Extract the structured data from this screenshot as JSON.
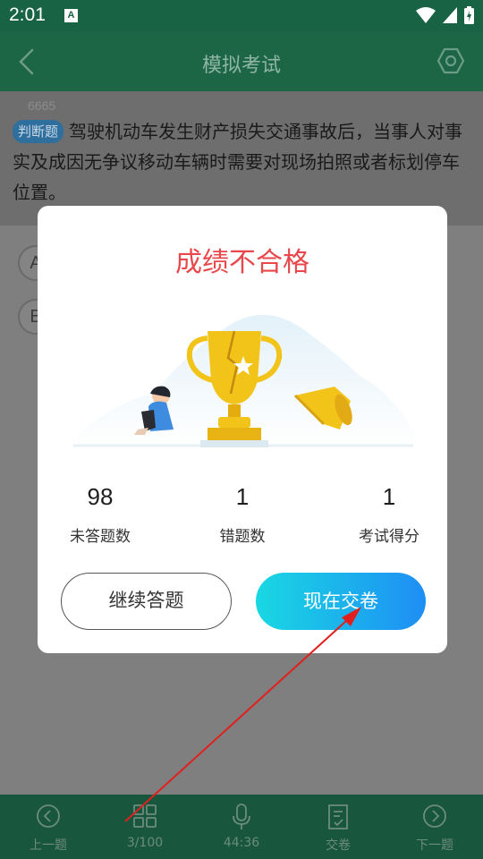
{
  "status": {
    "time": "2:01",
    "app_icon_letter": "A"
  },
  "header": {
    "title": "模拟考试"
  },
  "question": {
    "number": "6665",
    "type_badge": "判断题",
    "text": "驾驶机动车发生财产损失交通事故后，当事人对事实及成因无争议移动车辆时需要对现场拍照或者标划停车位置。",
    "options": [
      "A",
      "B"
    ]
  },
  "dialog": {
    "title": "成绩不合格",
    "stats": [
      {
        "value": "98",
        "label": "未答题数"
      },
      {
        "value": "1",
        "label": "错题数"
      },
      {
        "value": "1",
        "label": "考试得分"
      }
    ],
    "continue_label": "继续答题",
    "submit_label": "现在交卷"
  },
  "bottom_nav": {
    "items": [
      {
        "icon": "chevron-left-circle-icon",
        "label": "上一题"
      },
      {
        "icon": "grid-icon",
        "label": "3/100"
      },
      {
        "icon": "microphone-icon",
        "label": "44:36"
      },
      {
        "icon": "submit-paper-icon",
        "label": "交卷"
      },
      {
        "icon": "chevron-right-circle-icon",
        "label": "下一题"
      }
    ]
  },
  "colors": {
    "header_bg": "#1c6646",
    "title_fail": "#e8484c",
    "submit_gradient_start": "#19d8e2",
    "submit_gradient_end": "#1e8ef5",
    "annotation_arrow": "#e0201e"
  }
}
